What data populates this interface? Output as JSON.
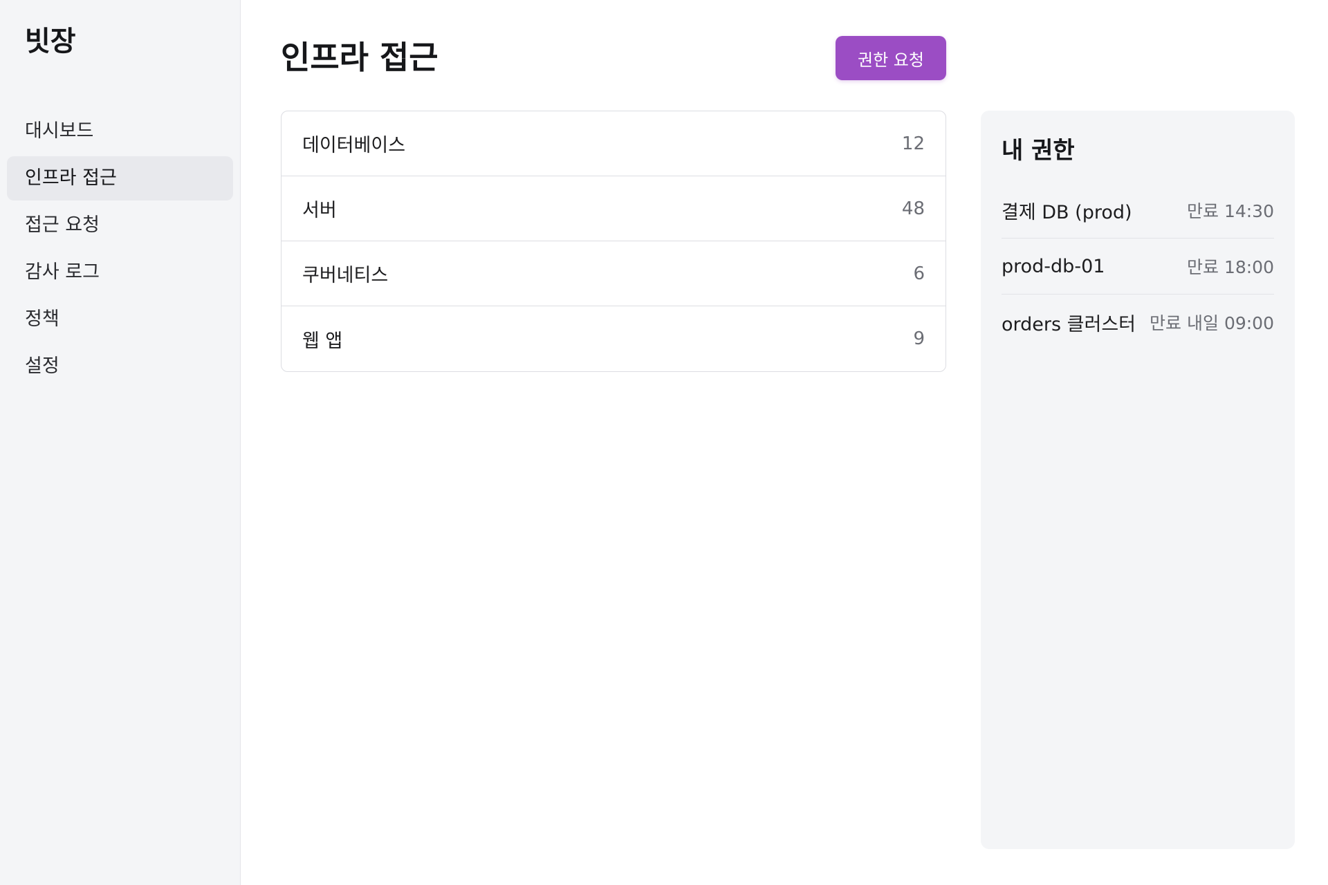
{
  "sidebar": {
    "brand": "빗장",
    "items": [
      {
        "label": "대시보드"
      },
      {
        "label": "인프라 접근"
      },
      {
        "label": "접근 요청"
      },
      {
        "label": "감사 로그"
      },
      {
        "label": "정책"
      },
      {
        "label": "설정"
      }
    ],
    "active_index": 1
  },
  "main": {
    "title": "인프라 접근",
    "request_button_label": "권한 요청",
    "resources": [
      {
        "name": "데이터베이스",
        "count": "12"
      },
      {
        "name": "서버",
        "count": "48"
      },
      {
        "name": "쿠버네티스",
        "count": "6"
      },
      {
        "name": "웹 앱",
        "count": "9"
      }
    ]
  },
  "permissions": {
    "title": "내 권한",
    "items": [
      {
        "name": "결제 DB (prod)",
        "expiry": "만료 14:30"
      },
      {
        "name": "prod-db-01",
        "expiry": "만료 18:00"
      },
      {
        "name": "orders 클러스터",
        "expiry": "만료 내일 09:00"
      }
    ]
  },
  "colors": {
    "accent": "#9b4dc4",
    "sidebar_bg": "#f4f5f7",
    "active_item_bg": "#e8e9ed"
  }
}
